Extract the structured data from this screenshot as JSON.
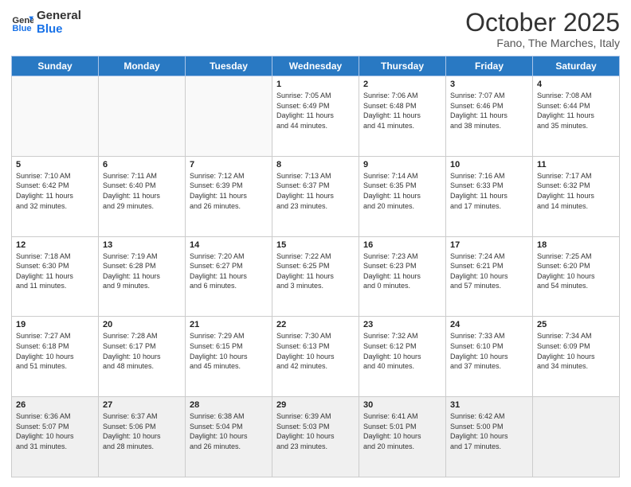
{
  "header": {
    "logo_general": "General",
    "logo_blue": "Blue",
    "month": "October 2025",
    "location": "Fano, The Marches, Italy"
  },
  "days_of_week": [
    "Sunday",
    "Monday",
    "Tuesday",
    "Wednesday",
    "Thursday",
    "Friday",
    "Saturday"
  ],
  "weeks": [
    [
      {
        "day": "",
        "info": ""
      },
      {
        "day": "",
        "info": ""
      },
      {
        "day": "",
        "info": ""
      },
      {
        "day": "1",
        "info": "Sunrise: 7:05 AM\nSunset: 6:49 PM\nDaylight: 11 hours\nand 44 minutes."
      },
      {
        "day": "2",
        "info": "Sunrise: 7:06 AM\nSunset: 6:48 PM\nDaylight: 11 hours\nand 41 minutes."
      },
      {
        "day": "3",
        "info": "Sunrise: 7:07 AM\nSunset: 6:46 PM\nDaylight: 11 hours\nand 38 minutes."
      },
      {
        "day": "4",
        "info": "Sunrise: 7:08 AM\nSunset: 6:44 PM\nDaylight: 11 hours\nand 35 minutes."
      }
    ],
    [
      {
        "day": "5",
        "info": "Sunrise: 7:10 AM\nSunset: 6:42 PM\nDaylight: 11 hours\nand 32 minutes."
      },
      {
        "day": "6",
        "info": "Sunrise: 7:11 AM\nSunset: 6:40 PM\nDaylight: 11 hours\nand 29 minutes."
      },
      {
        "day": "7",
        "info": "Sunrise: 7:12 AM\nSunset: 6:39 PM\nDaylight: 11 hours\nand 26 minutes."
      },
      {
        "day": "8",
        "info": "Sunrise: 7:13 AM\nSunset: 6:37 PM\nDaylight: 11 hours\nand 23 minutes."
      },
      {
        "day": "9",
        "info": "Sunrise: 7:14 AM\nSunset: 6:35 PM\nDaylight: 11 hours\nand 20 minutes."
      },
      {
        "day": "10",
        "info": "Sunrise: 7:16 AM\nSunset: 6:33 PM\nDaylight: 11 hours\nand 17 minutes."
      },
      {
        "day": "11",
        "info": "Sunrise: 7:17 AM\nSunset: 6:32 PM\nDaylight: 11 hours\nand 14 minutes."
      }
    ],
    [
      {
        "day": "12",
        "info": "Sunrise: 7:18 AM\nSunset: 6:30 PM\nDaylight: 11 hours\nand 11 minutes."
      },
      {
        "day": "13",
        "info": "Sunrise: 7:19 AM\nSunset: 6:28 PM\nDaylight: 11 hours\nand 9 minutes."
      },
      {
        "day": "14",
        "info": "Sunrise: 7:20 AM\nSunset: 6:27 PM\nDaylight: 11 hours\nand 6 minutes."
      },
      {
        "day": "15",
        "info": "Sunrise: 7:22 AM\nSunset: 6:25 PM\nDaylight: 11 hours\nand 3 minutes."
      },
      {
        "day": "16",
        "info": "Sunrise: 7:23 AM\nSunset: 6:23 PM\nDaylight: 11 hours\nand 0 minutes."
      },
      {
        "day": "17",
        "info": "Sunrise: 7:24 AM\nSunset: 6:21 PM\nDaylight: 10 hours\nand 57 minutes."
      },
      {
        "day": "18",
        "info": "Sunrise: 7:25 AM\nSunset: 6:20 PM\nDaylight: 10 hours\nand 54 minutes."
      }
    ],
    [
      {
        "day": "19",
        "info": "Sunrise: 7:27 AM\nSunset: 6:18 PM\nDaylight: 10 hours\nand 51 minutes."
      },
      {
        "day": "20",
        "info": "Sunrise: 7:28 AM\nSunset: 6:17 PM\nDaylight: 10 hours\nand 48 minutes."
      },
      {
        "day": "21",
        "info": "Sunrise: 7:29 AM\nSunset: 6:15 PM\nDaylight: 10 hours\nand 45 minutes."
      },
      {
        "day": "22",
        "info": "Sunrise: 7:30 AM\nSunset: 6:13 PM\nDaylight: 10 hours\nand 42 minutes."
      },
      {
        "day": "23",
        "info": "Sunrise: 7:32 AM\nSunset: 6:12 PM\nDaylight: 10 hours\nand 40 minutes."
      },
      {
        "day": "24",
        "info": "Sunrise: 7:33 AM\nSunset: 6:10 PM\nDaylight: 10 hours\nand 37 minutes."
      },
      {
        "day": "25",
        "info": "Sunrise: 7:34 AM\nSunset: 6:09 PM\nDaylight: 10 hours\nand 34 minutes."
      }
    ],
    [
      {
        "day": "26",
        "info": "Sunrise: 6:36 AM\nSunset: 5:07 PM\nDaylight: 10 hours\nand 31 minutes."
      },
      {
        "day": "27",
        "info": "Sunrise: 6:37 AM\nSunset: 5:06 PM\nDaylight: 10 hours\nand 28 minutes."
      },
      {
        "day": "28",
        "info": "Sunrise: 6:38 AM\nSunset: 5:04 PM\nDaylight: 10 hours\nand 26 minutes."
      },
      {
        "day": "29",
        "info": "Sunrise: 6:39 AM\nSunset: 5:03 PM\nDaylight: 10 hours\nand 23 minutes."
      },
      {
        "day": "30",
        "info": "Sunrise: 6:41 AM\nSunset: 5:01 PM\nDaylight: 10 hours\nand 20 minutes."
      },
      {
        "day": "31",
        "info": "Sunrise: 6:42 AM\nSunset: 5:00 PM\nDaylight: 10 hours\nand 17 minutes."
      },
      {
        "day": "",
        "info": ""
      }
    ]
  ]
}
